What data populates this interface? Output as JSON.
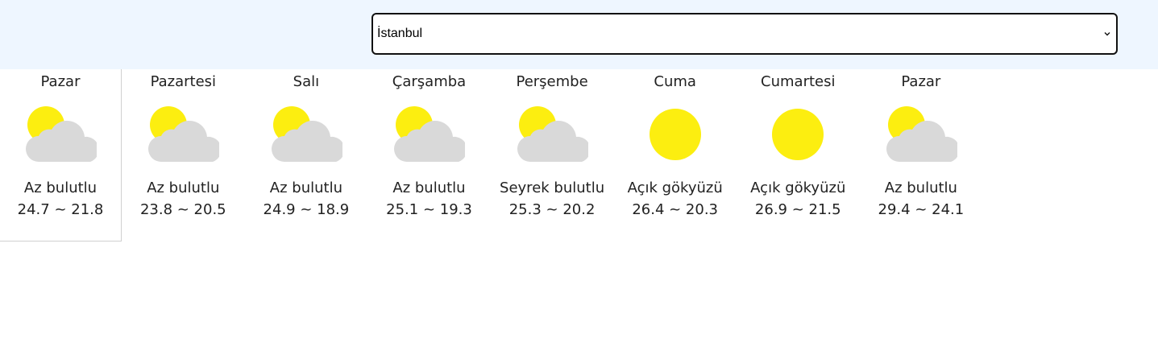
{
  "city_select": {
    "selected": "İstanbul"
  },
  "colors": {
    "sun": "#fcee10",
    "cloud": "#d9d9d9",
    "header_bg": "#eef6ff"
  },
  "forecast": [
    {
      "day": "Pazar",
      "icon": "partly-cloudy-icon",
      "desc": "Az bulutlu",
      "temps": "24.7 ~ 21.8",
      "selected": true
    },
    {
      "day": "Pazartesi",
      "icon": "partly-cloudy-icon",
      "desc": "Az bulutlu",
      "temps": "23.8 ~ 20.5"
    },
    {
      "day": "Salı",
      "icon": "partly-cloudy-icon",
      "desc": "Az bulutlu",
      "temps": "24.9 ~ 18.9"
    },
    {
      "day": "Çarşamba",
      "icon": "partly-cloudy-icon",
      "desc": "Az bulutlu",
      "temps": "25.1 ~ 19.3"
    },
    {
      "day": "Perşembe",
      "icon": "partly-cloudy-icon",
      "desc": "Seyrek bulutlu",
      "temps": "25.3 ~ 20.2"
    },
    {
      "day": "Cuma",
      "icon": "sun-icon",
      "desc": "Açık gökyüzü",
      "temps": "26.4 ~ 20.3"
    },
    {
      "day": "Cumartesi",
      "icon": "sun-icon",
      "desc": "Açık gökyüzü",
      "temps": "26.9 ~ 21.5"
    },
    {
      "day": "Pazar",
      "icon": "partly-cloudy-icon",
      "desc": "Az bulutlu",
      "temps": "29.4 ~ 24.1"
    }
  ]
}
